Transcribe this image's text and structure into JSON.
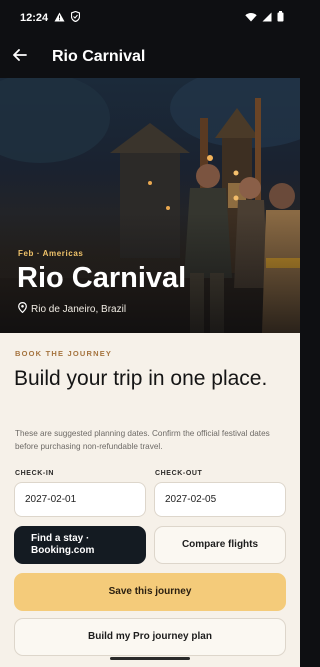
{
  "status_bar": {
    "time": "12:24"
  },
  "app_bar": {
    "title": "Rio Carnival"
  },
  "hero": {
    "tag": "Feb · Americas",
    "title": "Rio Carnival",
    "location": "Rio de Janeiro, Brazil"
  },
  "booking": {
    "eyebrow": "BOOK THE JOURNEY",
    "headline": "Build your trip in one place.",
    "note": "These are suggested planning dates. Confirm the official festival dates before purchasing non-refundable travel.",
    "check_in": {
      "label": "CHECK-IN",
      "value": "2027-02-01"
    },
    "check_out": {
      "label": "CHECK-OUT",
      "value": "2027-02-05"
    },
    "stay_button_line1": "Find a stay ·",
    "stay_button_line2": "Booking.com",
    "flights_button": "Compare flights",
    "save_button": "Save this journey",
    "pro_button": "Build my Pro journey plan"
  },
  "colors": {
    "accent": "#f4cb7a",
    "eyebrow": "#a5743f",
    "dark_button": "#141b22",
    "background": "#f6f1e9"
  }
}
